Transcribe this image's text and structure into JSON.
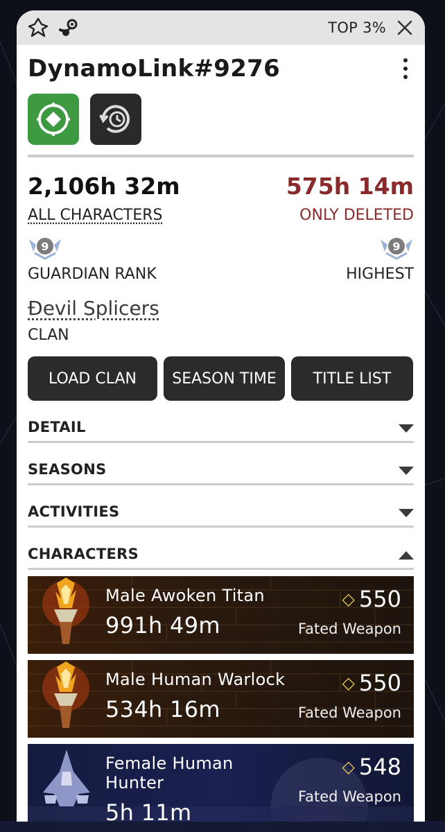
{
  "header": {
    "rank_percent": "TOP 3%",
    "platform_icons": [
      "destiny-logo-icon",
      "steam-icon"
    ]
  },
  "profile": {
    "name": "DynamoLink#9276",
    "badges": [
      "green-target-badge",
      "clock-refresh-badge"
    ]
  },
  "stats": {
    "total_time": "2,106h 32m",
    "total_label": "ALL CHARACTERS",
    "deleted_time": "575h 14m",
    "deleted_label": "ONLY DELETED",
    "guardian_rank_value": "9",
    "guardian_rank_label": "GUARDIAN RANK",
    "highest_rank_value": "9",
    "highest_rank_label": "HIGHEST"
  },
  "clan": {
    "name": "Ɖevil Splicers",
    "label": "CLAN"
  },
  "buttons": {
    "load_clan": "LOAD CLAN",
    "season_time": "SEASON TIME",
    "title_list": "TITLE LIST"
  },
  "sections": [
    {
      "title": "DETAIL",
      "state": "collapsed"
    },
    {
      "title": "SEASONS",
      "state": "collapsed"
    },
    {
      "title": "ACTIVITIES",
      "state": "collapsed"
    },
    {
      "title": "CHARACTERS",
      "state": "expanded"
    }
  ],
  "characters": [
    {
      "name": "Male Awoken Titan",
      "time": "991h 49m",
      "power": "550",
      "emblem": "Fated Weapon"
    },
    {
      "name": "Male Human Warlock",
      "time": "534h 16m",
      "power": "550",
      "emblem": "Fated Weapon"
    },
    {
      "name": "Female Human Hunter",
      "time": "5h 11m",
      "power": "548",
      "emblem": "Fated Weapon"
    }
  ],
  "colors": {
    "accent_red": "#8a2b2b",
    "button_dark": "#2b2b2b",
    "badge_green": "#3e9a41",
    "power_gold": "#f2cf5b"
  }
}
